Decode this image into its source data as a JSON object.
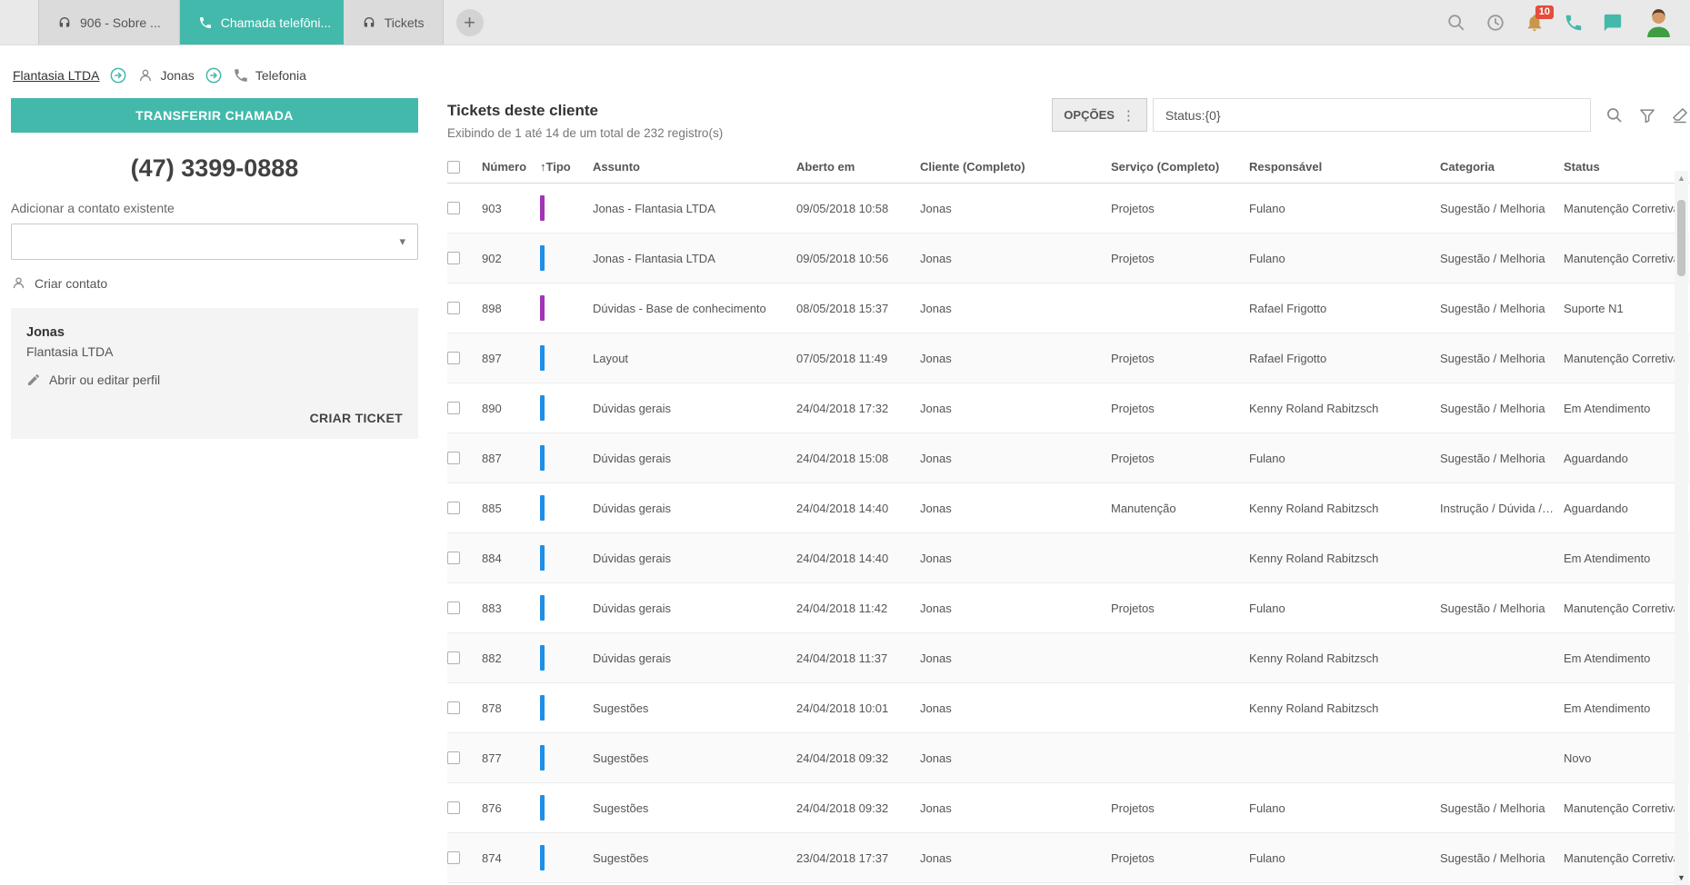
{
  "theme": {
    "accent": "#43b9ab",
    "badge_red": "#e74c3c",
    "type_colors": {
      "blue": "#1f8fe5",
      "purple": "#a234b5"
    }
  },
  "tabs": [
    {
      "label": "906 - Sobre ...",
      "icon": "headset-icon",
      "active": false
    },
    {
      "label": "Chamada telefôni...",
      "icon": "phone-icon",
      "active": true
    },
    {
      "label": "Tickets",
      "icon": "headset-icon",
      "active": false
    }
  ],
  "topbar": {
    "notifications_badge": "10"
  },
  "breadcrumb": {
    "company": "Flantasia LTDA",
    "contact": "Jonas",
    "section": "Telefonia"
  },
  "sidebar": {
    "transfer_call_button": "TRANSFERIR CHAMADA",
    "phone_number": "(47) 3399-0888",
    "add_to_existing_contact_label": "Adicionar a contato existente",
    "contact_select_value": "",
    "create_contact_link": "Criar contato",
    "contact_card": {
      "name": "Jonas",
      "company": "Flantasia LTDA",
      "edit_profile_link": "Abrir ou editar perfil",
      "create_ticket_button": "CRIAR TICKET"
    }
  },
  "main": {
    "title": "Tickets deste cliente",
    "subtitle": "Exibindo de 1 até 14 de um total de 232 registro(s)",
    "options_button": "OPÇÕES",
    "filter_value": "Status:{0}",
    "table": {
      "sorted_by": "Tipo",
      "sort_icon": "↑",
      "headers": [
        "Número",
        "Tipo",
        "Assunto",
        "Aberto em",
        "Cliente (Completo)",
        "Serviço (Completo)",
        "Responsável",
        "Categoria",
        "Status"
      ],
      "rows": [
        {
          "numero": "903",
          "tipo_color": "purple",
          "assunto": "Jonas - Flantasia LTDA",
          "aberto_em": "09/05/2018 10:58",
          "cliente": "Jonas",
          "servico": "Projetos",
          "responsavel": "Fulano",
          "categoria": "Sugestão / Melhoria",
          "status": "Manutenção Corretiva"
        },
        {
          "numero": "902",
          "tipo_color": "blue",
          "assunto": "Jonas - Flantasia LTDA",
          "aberto_em": "09/05/2018 10:56",
          "cliente": "Jonas",
          "servico": "Projetos",
          "responsavel": "Fulano",
          "categoria": "Sugestão / Melhoria",
          "status": "Manutenção Corretiva"
        },
        {
          "numero": "898",
          "tipo_color": "purple",
          "assunto": "Dúvidas - Base de conhecimento",
          "aberto_em": "08/05/2018 15:37",
          "cliente": "Jonas",
          "servico": "",
          "responsavel": "Rafael Frigotto",
          "categoria": "Sugestão / Melhoria",
          "status": "Suporte N1"
        },
        {
          "numero": "897",
          "tipo_color": "blue",
          "assunto": "Layout",
          "aberto_em": "07/05/2018 11:49",
          "cliente": "Jonas",
          "servico": "Projetos",
          "responsavel": "Rafael Frigotto",
          "categoria": "Sugestão / Melhoria",
          "status": "Manutenção Corretiva"
        },
        {
          "numero": "890",
          "tipo_color": "blue",
          "assunto": "Dúvidas gerais",
          "aberto_em": "24/04/2018 17:32",
          "cliente": "Jonas",
          "servico": "Projetos",
          "responsavel": "Kenny Roland Rabitzsch",
          "categoria": "Sugestão / Melhoria",
          "status": "Em Atendimento"
        },
        {
          "numero": "887",
          "tipo_color": "blue",
          "assunto": "Dúvidas gerais",
          "aberto_em": "24/04/2018 15:08",
          "cliente": "Jonas",
          "servico": "Projetos",
          "responsavel": "Fulano",
          "categoria": "Sugestão / Melhoria",
          "status": "Aguardando"
        },
        {
          "numero": "885",
          "tipo_color": "blue",
          "assunto": "Dúvidas gerais",
          "aberto_em": "24/04/2018 14:40",
          "cliente": "Jonas",
          "servico": "Manutenção",
          "responsavel": "Kenny Roland Rabitzsch",
          "categoria": "Instrução / Dúvida / C...",
          "status": "Aguardando"
        },
        {
          "numero": "884",
          "tipo_color": "blue",
          "assunto": "Dúvidas gerais",
          "aberto_em": "24/04/2018 14:40",
          "cliente": "Jonas",
          "servico": "",
          "responsavel": "Kenny Roland Rabitzsch",
          "categoria": "",
          "status": "Em Atendimento"
        },
        {
          "numero": "883",
          "tipo_color": "blue",
          "assunto": "Dúvidas gerais",
          "aberto_em": "24/04/2018 11:42",
          "cliente": "Jonas",
          "servico": "Projetos",
          "responsavel": "Fulano",
          "categoria": "Sugestão / Melhoria",
          "status": "Manutenção Corretiva"
        },
        {
          "numero": "882",
          "tipo_color": "blue",
          "assunto": "Dúvidas gerais",
          "aberto_em": "24/04/2018 11:37",
          "cliente": "Jonas",
          "servico": "",
          "responsavel": "Kenny Roland Rabitzsch",
          "categoria": "",
          "status": "Em Atendimento"
        },
        {
          "numero": "878",
          "tipo_color": "blue",
          "assunto": "Sugestões",
          "aberto_em": "24/04/2018 10:01",
          "cliente": "Jonas",
          "servico": "",
          "responsavel": "Kenny Roland Rabitzsch",
          "categoria": "",
          "status": "Em Atendimento"
        },
        {
          "numero": "877",
          "tipo_color": "blue",
          "assunto": "Sugestões",
          "aberto_em": "24/04/2018 09:32",
          "cliente": "Jonas",
          "servico": "",
          "responsavel": "",
          "categoria": "",
          "status": "Novo"
        },
        {
          "numero": "876",
          "tipo_color": "blue",
          "assunto": "Sugestões",
          "aberto_em": "24/04/2018 09:32",
          "cliente": "Jonas",
          "servico": "Projetos",
          "responsavel": "Fulano",
          "categoria": "Sugestão / Melhoria",
          "status": "Manutenção Corretiva"
        },
        {
          "numero": "874",
          "tipo_color": "blue",
          "assunto": "Sugestões",
          "aberto_em": "23/04/2018 17:37",
          "cliente": "Jonas",
          "servico": "Projetos",
          "responsavel": "Fulano",
          "categoria": "Sugestão / Melhoria",
          "status": "Manutenção Corretiva"
        }
      ]
    }
  }
}
